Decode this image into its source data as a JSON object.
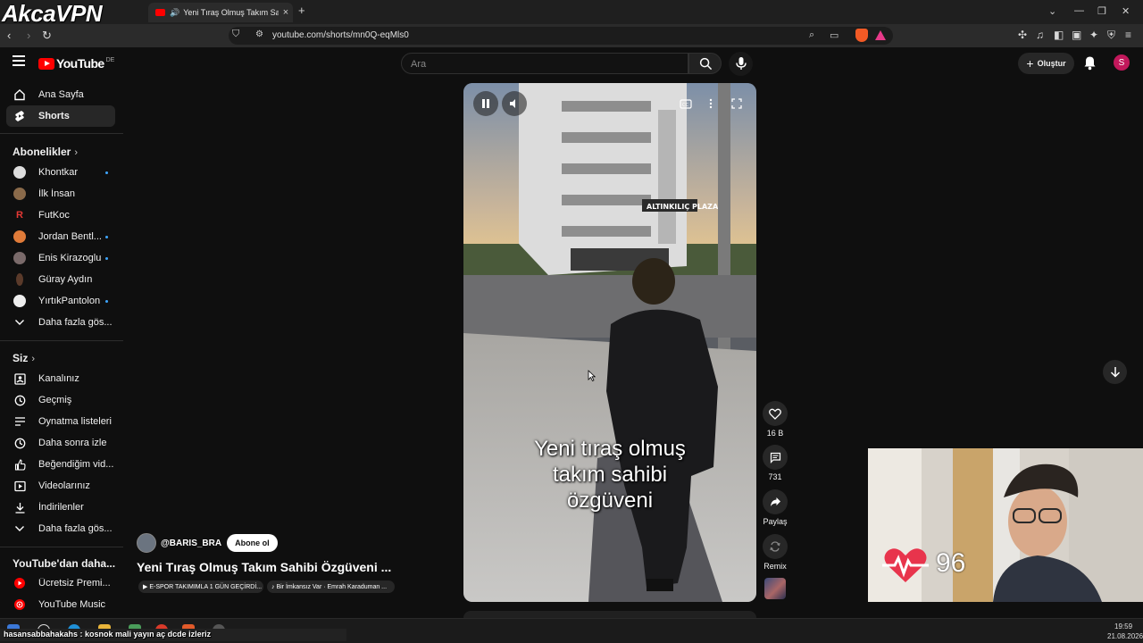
{
  "browser": {
    "watermark": "AkcaVPN",
    "tab_title": "Yeni Tıraş Olmuş Takım Sahibi",
    "tab_close": "×",
    "new_tab": "+",
    "url": "youtube.com/shorts/mn0Q-eqMls0"
  },
  "header": {
    "logo_text": "YouTube",
    "country_code": "DE",
    "search_placeholder": "Ara",
    "create_label": "Oluştur",
    "avatar_letter": "S"
  },
  "sidebar": {
    "main": [
      {
        "label": "Ana Sayfa",
        "icon": "home-icon"
      },
      {
        "label": "Shorts",
        "icon": "shorts-icon",
        "active": true
      }
    ],
    "subscriptions_title": "Abonelikler",
    "subscriptions": [
      {
        "label": "Khontkar",
        "dot": true,
        "color": "#dddddd"
      },
      {
        "label": "İlk İnsan",
        "dot": false,
        "color": "#8a6a4a"
      },
      {
        "label": "FutKoc",
        "dot": false,
        "color": "#e53935"
      },
      {
        "label": "Jordan Bentl...",
        "dot": true,
        "color": "#e07b39"
      },
      {
        "label": "Enis Kirazoglu",
        "dot": true,
        "color": "#7a6a6a"
      },
      {
        "label": "Güray Aydın",
        "dot": false,
        "color": "#5a3a2a"
      },
      {
        "label": "YırtıkPantolon",
        "dot": true,
        "color": "#eeeeee"
      },
      {
        "label": "Daha fazla gös...",
        "dot": false,
        "chevron": true
      }
    ],
    "you_title": "Siz",
    "you": [
      {
        "label": "Kanalınız",
        "icon": "channel-icon"
      },
      {
        "label": "Geçmiş",
        "icon": "history-icon"
      },
      {
        "label": "Oynatma listeleri",
        "icon": "playlist-icon"
      },
      {
        "label": "Daha sonra izle",
        "icon": "clock-icon"
      },
      {
        "label": "Beğendiğim vid...",
        "icon": "like-icon"
      },
      {
        "label": "Videolarınız",
        "icon": "video-icon"
      },
      {
        "label": "İndirilenler",
        "icon": "download-icon"
      },
      {
        "label": "Daha fazla gös...",
        "icon": "chevron-down-icon"
      }
    ],
    "more_title": "YouTube'dan daha...",
    "more": [
      {
        "label": "Ücretsiz Premi...",
        "icon": "youtube-premium-icon"
      },
      {
        "label": "YouTube Music",
        "icon": "youtube-music-icon"
      }
    ]
  },
  "short": {
    "caption_line1": "Yeni tıraş olmuş",
    "caption_line2": "takım sahibi",
    "caption_line3": "özgüveni",
    "channel_handle": "@BARIS_BRA",
    "subscribe_label": "Abone ol",
    "title": "Yeni Tıraş Olmuş Takım Sahibi Özgüveni ...",
    "chip1": "▶ E-SPOR TAKIMIMLA 1 GÜN GEÇİRDİ...",
    "chip2": "♪ Bir İmkansız Var · Emrah Karaduman ...",
    "likes": "16 B",
    "comments": "731",
    "share_label": "Paylaş",
    "remix_label": "Remix"
  },
  "overlay": {
    "heart_rate": "96",
    "ticker": "hasansabbahakahs : kosnok mali yayın aç dcde izleriz"
  },
  "taskbar": {
    "time": "19:59",
    "date": "21.08.2026"
  }
}
